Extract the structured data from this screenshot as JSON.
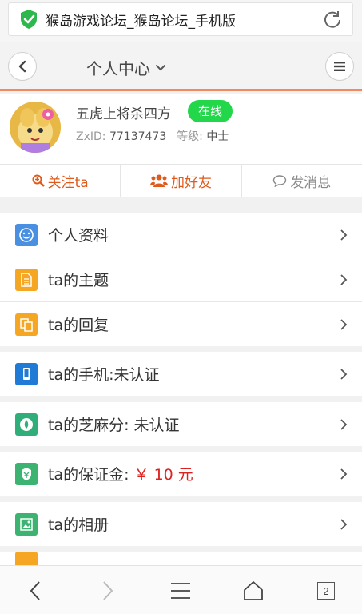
{
  "browser": {
    "page_title": "猴岛游戏论坛_猴岛论坛_手机版",
    "tab_count": "2"
  },
  "header": {
    "title": "个人中心"
  },
  "profile": {
    "username": "五虎上将杀四方",
    "status": "在线",
    "zxid_label": "ZxID:",
    "zxid": "77137473",
    "level_label": "等级:",
    "level": "中士"
  },
  "actions": {
    "follow": "关注ta",
    "add_friend": "加好友",
    "message": "发消息"
  },
  "menu": [
    {
      "label": "个人资料",
      "icon": "smiley-icon",
      "color": "#4a90e2"
    },
    {
      "label": "ta的主题",
      "icon": "document-icon",
      "color": "#f5a623"
    },
    {
      "label": "ta的回复",
      "icon": "reply-icon",
      "color": "#f5a623"
    },
    {
      "label": "ta的手机:未认证",
      "icon": "phone-icon",
      "color": "#1f7bd6"
    },
    {
      "label": "ta的芝麻分: 未认证",
      "icon": "sesame-icon",
      "color": "#2fae7a"
    },
    {
      "label_prefix": "ta的保证金:",
      "money": "￥ 10 元",
      "icon": "deposit-icon",
      "color": "#3cb371"
    },
    {
      "label": "ta的相册",
      "icon": "album-icon",
      "color": "#3cb371"
    }
  ],
  "colors": {
    "accent": "#e05a1c",
    "header_border": "#f28a60",
    "online": "#22d84a"
  }
}
